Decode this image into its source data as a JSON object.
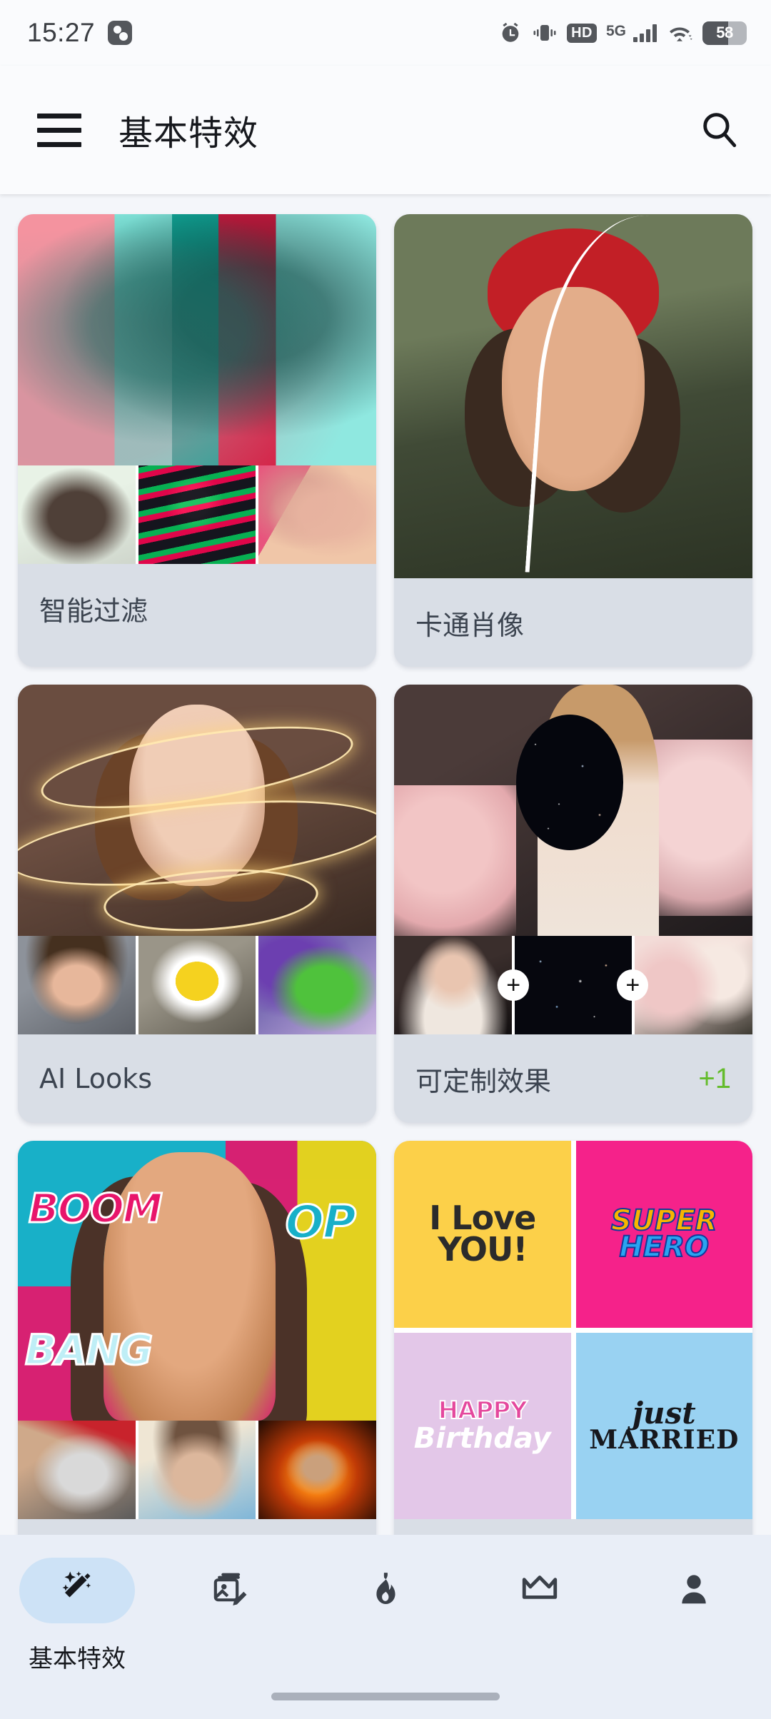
{
  "status_bar": {
    "time": "15:27",
    "app_icon": "sharing-icon",
    "icons": [
      "alarm-icon",
      "vibrate-icon",
      "hd-icon",
      "5g-icon",
      "signal-icon",
      "wifi-icon",
      "battery-icon"
    ],
    "hd_label": "HD",
    "network_label": "5G",
    "battery_percent": "58"
  },
  "app_bar": {
    "menu_icon": "hamburger-menu-icon",
    "title": "基本特效",
    "search_icon": "search-icon"
  },
  "cards": [
    {
      "title": "智能过滤",
      "badge": "",
      "layout": "hero-thumbs",
      "thumb_count": 3,
      "has_plus_marks": false
    },
    {
      "title": "卡通肖像",
      "badge": "",
      "layout": "hero-only",
      "thumb_count": 0,
      "has_plus_marks": false
    },
    {
      "title": "AI Looks",
      "badge": "",
      "layout": "hero-thumbs",
      "thumb_count": 3,
      "has_plus_marks": false
    },
    {
      "title": "可定制效果",
      "badge": "+1",
      "layout": "hero-thumbs",
      "thumb_count": 3,
      "has_plus_marks": true,
      "plus_label": "+"
    },
    {
      "title": "",
      "badge": "",
      "layout": "hero-thumbs",
      "thumb_count": 3,
      "has_plus_marks": false
    },
    {
      "title": "",
      "badge": "",
      "layout": "sticker-grid",
      "thumb_count": 0,
      "has_plus_marks": false
    }
  ],
  "stickers": {
    "love_line1": "I Love",
    "love_line2": "YOU!",
    "hero_line1": "SUPER",
    "hero_line2": "HERO",
    "birthday_line1": "HAPPY",
    "birthday_line2": "Birthday",
    "married_line1": "just",
    "married_line2": "MARRIED"
  },
  "comic_words": {
    "boom": "BOOM",
    "pop": "OP",
    "bang": "BANG"
  },
  "bottom_nav": {
    "items": [
      {
        "label": "基本特效",
        "icon": "magic-wand-icon",
        "active": true
      },
      {
        "label": "",
        "icon": "photo-editor-icon",
        "active": false
      },
      {
        "label": "",
        "icon": "flame-icon",
        "active": false
      },
      {
        "label": "",
        "icon": "crown-icon",
        "active": false
      },
      {
        "label": "",
        "icon": "person-icon",
        "active": false
      }
    ]
  },
  "colors": {
    "page_background": "#f4f6fa",
    "app_bar_background": "#fafbfd",
    "card_label_background": "#d9dee6",
    "badge_green": "#64bc2c",
    "nav_background": "#e9eef7",
    "nav_active_pill": "#cde2f6",
    "icon_dark": "#16181d"
  }
}
